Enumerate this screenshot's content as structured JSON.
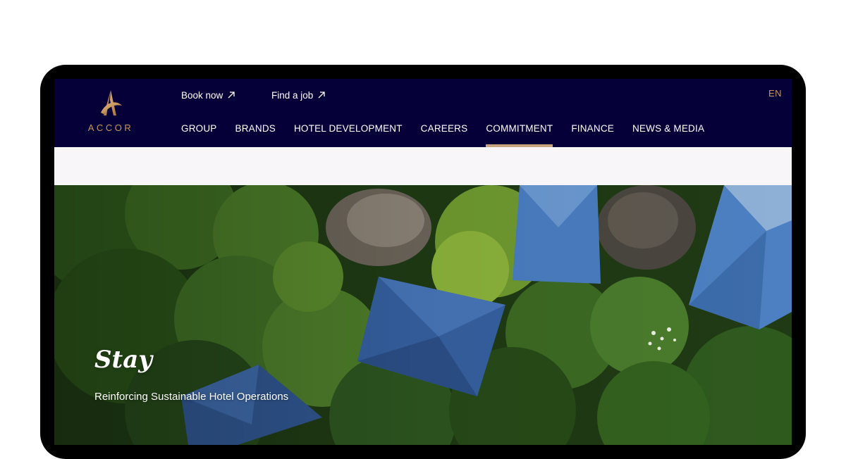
{
  "brand": {
    "name": "ACCOR",
    "logo_icon": "accor-logo-icon",
    "accent_color": "#c8955e",
    "nav_bg": "#050038"
  },
  "utility_nav": [
    {
      "label": "Book now",
      "icon": "external-arrow-icon"
    },
    {
      "label": "Find a job",
      "icon": "external-arrow-icon"
    }
  ],
  "language": "EN",
  "main_nav": [
    {
      "label": "GROUP"
    },
    {
      "label": "BRANDS"
    },
    {
      "label": "HOTEL DEVELOPMENT"
    },
    {
      "label": "CAREERS"
    },
    {
      "label": "COMMITMENT",
      "active": true
    },
    {
      "label": "FINANCE"
    },
    {
      "label": "NEWS & MEDIA"
    }
  ],
  "hero": {
    "title": "Stay",
    "subtitle": "Reinforcing Sustainable Hotel Operations"
  }
}
